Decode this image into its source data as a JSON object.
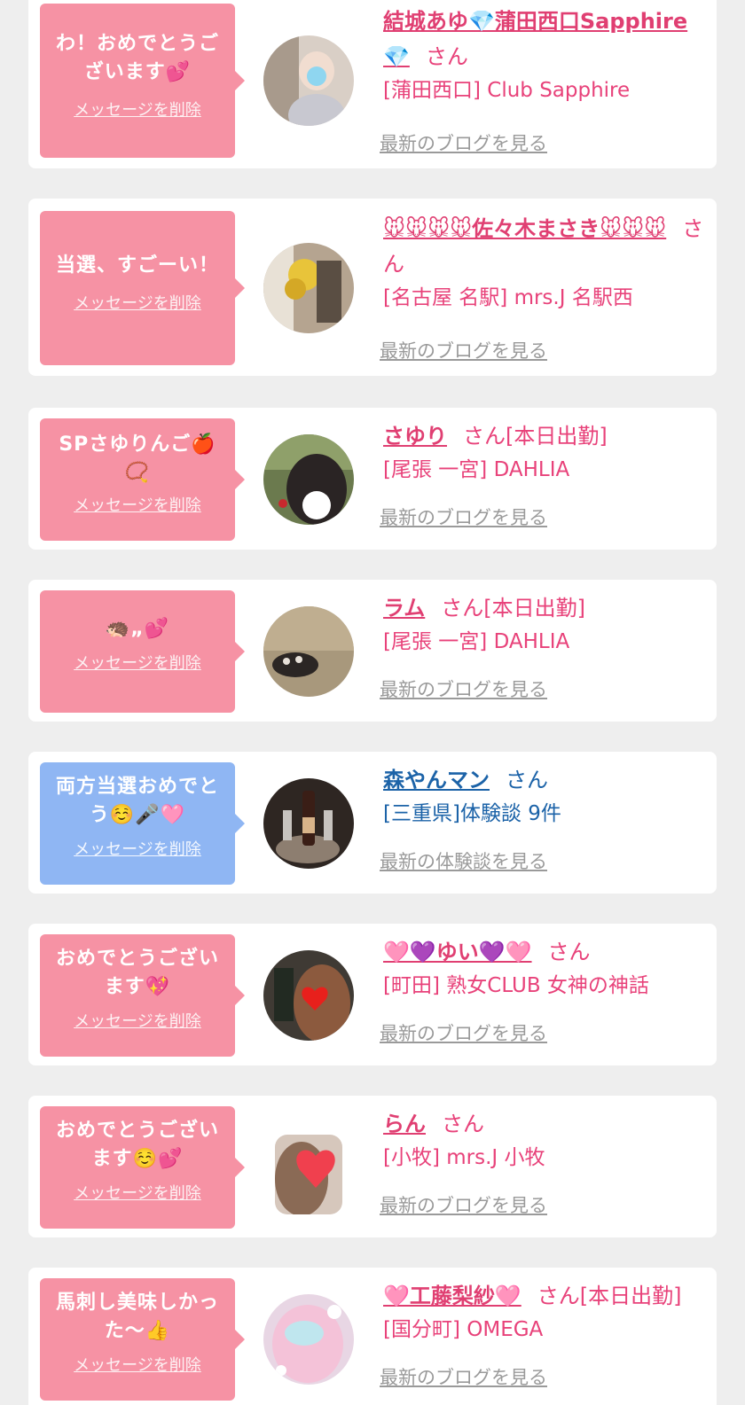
{
  "cards": [
    {
      "message": "わ！おめでとうございます💕",
      "delete_label": "メッセージを削除",
      "name": "結城あゆ💎蒲田西口Sapphire💎",
      "san": "さん",
      "status": "",
      "shop": "[蒲田西口] Club Sapphire",
      "blog_link": "最新のブログを見る",
      "theme": "pink"
    },
    {
      "message": "当選、すごーい！",
      "delete_label": "メッセージを削除",
      "name": "🐭🐭🐭🐭佐々木まさき🐭🐭🐭",
      "san": "さん",
      "status": "",
      "shop": "[名古屋 名駅] mrs.J 名駅西",
      "blog_link": "最新のブログを見る",
      "theme": "pink"
    },
    {
      "message": "SPさゆりんご🍎📿",
      "delete_label": "メッセージを削除",
      "name": "さゆり",
      "san": "さん",
      "status": "[本日出勤]",
      "shop": "[尾張 一宮] DAHLIA",
      "blog_link": "最新のブログを見る",
      "theme": "pink"
    },
    {
      "message": "🦔„💕",
      "delete_label": "メッセージを削除",
      "name": "ラム",
      "san": "さん",
      "status": "[本日出勤]",
      "shop": "[尾張 一宮] DAHLIA",
      "blog_link": "最新のブログを見る",
      "theme": "pink"
    },
    {
      "message": "両方当選おめでとう☺️🎤🩷",
      "delete_label": "メッセージを削除",
      "name": "森やんマン",
      "san": "さん",
      "status": "",
      "shop": "[三重県]体験談 9件",
      "blog_link": "最新の体験談を見る",
      "theme": "blue"
    },
    {
      "message": "おめでとうございます💖",
      "delete_label": "メッセージを削除",
      "name": "🩷💜ゆい💜🩷",
      "san": "さん",
      "status": "",
      "shop": "[町田] 熟女CLUB 女神の神話",
      "blog_link": "最新のブログを見る",
      "theme": "pink"
    },
    {
      "message": "おめでとうございます☺️💕",
      "delete_label": "メッセージを削除",
      "name": "らん",
      "san": "さん",
      "status": "",
      "shop": "[小牧] mrs.J 小牧",
      "blog_link": "最新のブログを見る",
      "theme": "pink"
    },
    {
      "message": "馬刺し美味しかった〜👍",
      "delete_label": "メッセージを削除",
      "name": "🩷工藤梨紗🩷",
      "san": "さん",
      "status": "[本日出勤]",
      "shop": "[国分町] OMEGA",
      "blog_link": "最新のブログを見る",
      "theme": "pink"
    }
  ],
  "colors": {
    "background": "#eeeeee",
    "bubble_pink": "#f692a4",
    "bubble_blue": "#8fb6f3",
    "name_pink": "#e03f72",
    "name_blue": "#1c63a8",
    "link_gray": "#9a9a9a"
  }
}
